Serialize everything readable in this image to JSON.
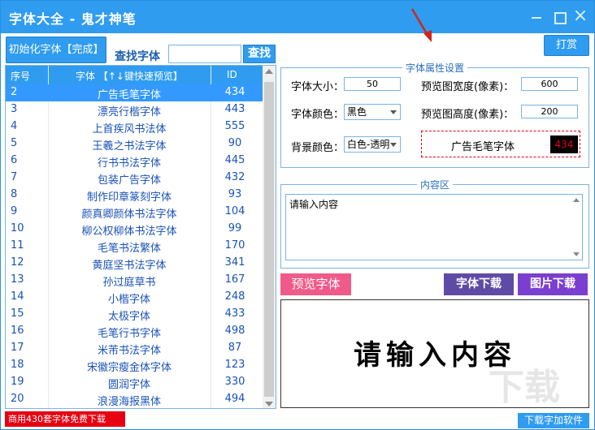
{
  "window": {
    "title": "字体大全 - 鬼才神笔"
  },
  "toolbar": {
    "init_label": "初始化字体【完成】",
    "find_label": "查找字体",
    "find_value": "",
    "find_button": "查找",
    "reward_button": "打赏"
  },
  "list": {
    "headers": {
      "no": "序号",
      "name": "字体 【↑↓键快速预览】",
      "id": "ID"
    },
    "rows": [
      {
        "no": "2",
        "name": "广告毛笔字体",
        "id": "434"
      },
      {
        "no": "3",
        "name": "漂亮行楷字体",
        "id": "443"
      },
      {
        "no": "4",
        "name": "上首疾风书法体",
        "id": "555"
      },
      {
        "no": "5",
        "name": "王羲之书法字体",
        "id": "90"
      },
      {
        "no": "6",
        "name": "行书书法字体",
        "id": "445"
      },
      {
        "no": "7",
        "name": "包装广告字体",
        "id": "432"
      },
      {
        "no": "8",
        "name": "制作印章篆刻字体",
        "id": "93"
      },
      {
        "no": "9",
        "name": "颜真卿颜体书法字体",
        "id": "104"
      },
      {
        "no": "10",
        "name": "柳公权柳体书法字体",
        "id": "99"
      },
      {
        "no": "11",
        "name": "毛笔书法繁体",
        "id": "170"
      },
      {
        "no": "12",
        "name": "黄庭坚书法字体",
        "id": "341"
      },
      {
        "no": "13",
        "name": "孙过庭草书",
        "id": "167"
      },
      {
        "no": "14",
        "name": "小楷字体",
        "id": "248"
      },
      {
        "no": "15",
        "name": "太极字体",
        "id": "433"
      },
      {
        "no": "16",
        "name": "毛笔行书字体",
        "id": "498"
      },
      {
        "no": "17",
        "name": "米芾书法字体",
        "id": "87"
      },
      {
        "no": "18",
        "name": "宋徽宗瘦金体字体",
        "id": "123"
      },
      {
        "no": "19",
        "name": "圆润字体",
        "id": "330"
      },
      {
        "no": "20",
        "name": "浪漫海报黑体",
        "id": "494"
      }
    ]
  },
  "promo": "商用430套字体免费下载",
  "attrs": {
    "legend": "字体属性设置",
    "size_label": "字体大小：",
    "size_value": "50",
    "width_label": "预览图宽度(像素)：",
    "width_value": "600",
    "color_label": "字体颜色：",
    "color_value": "黑色",
    "height_label": "预览图高度(像素)：",
    "height_value": "200",
    "bg_label": "背景颜色：",
    "bg_value": "白色-透明",
    "mini_name": "广告毛笔字体",
    "mini_id": "434"
  },
  "content": {
    "legend": "内容区",
    "text": "请输入内容"
  },
  "actions": {
    "preview": "预览字体",
    "font_download": "字体下载",
    "image_download": "图片下载",
    "more_download": "下载字加软件"
  },
  "preview_text": "请输入内容",
  "watermark": "下载"
}
